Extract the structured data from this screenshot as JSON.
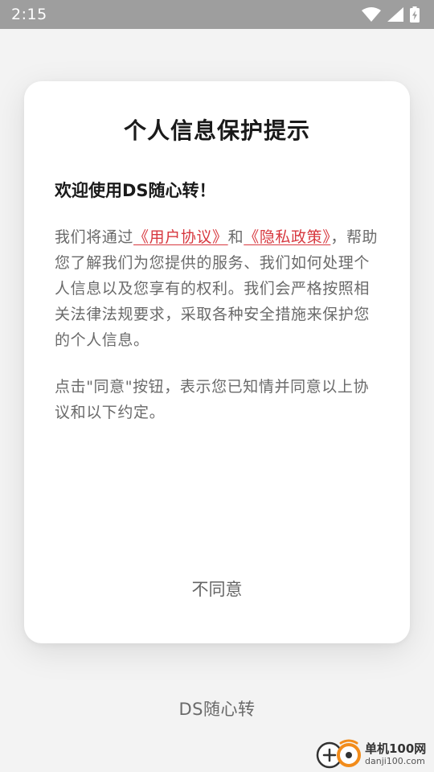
{
  "status_bar": {
    "time": "2:15",
    "icons": [
      "wifi-icon",
      "signal-icon",
      "battery-charging-icon"
    ]
  },
  "dialog": {
    "title": "个人信息保护提示",
    "welcome": "欢迎使用DS随心转！",
    "paragraph1": {
      "prefix": "我们将通过",
      "user_agreement": "《用户协议》",
      "and": "和",
      "privacy_policy": "《隐私政策》",
      "suffix": "，帮助您了解我们为您提供的服务、我们如何处理个人信息以及您享有的权利。我们会严格按照相关法律法规要求，采取各种安全措施来保护您的个人信息。"
    },
    "paragraph2": "点击\"同意\"按钮，表示您已知情并同意以上协议和以下约定。",
    "disagree_label": "不同意"
  },
  "footer": {
    "app_name": "DS随心转"
  },
  "watermark": {
    "name": "单机100网",
    "url": "danji100.com"
  },
  "colors": {
    "status_bar": "#9e9e9e",
    "link": "#d7383f",
    "background": "#f3f3f3",
    "dialog": "#ffffff"
  }
}
